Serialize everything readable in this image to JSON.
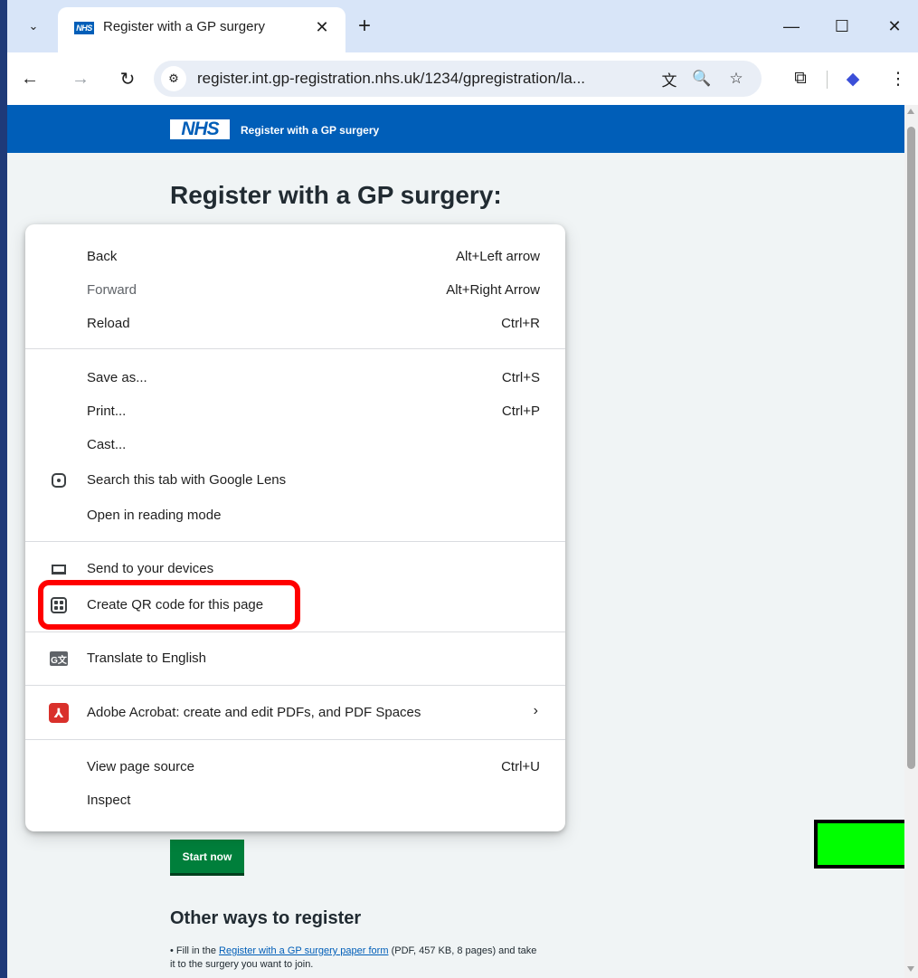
{
  "tab": {
    "favicon_text": "NHS",
    "title": "Register with a GP surgery",
    "close_glyph": "✕",
    "new_tab_glyph": "+",
    "search_glyph": "⌄"
  },
  "window_controls": {
    "minimize": "—",
    "maximize": "☐",
    "close": "✕"
  },
  "toolbar": {
    "back_glyph": "←",
    "forward_glyph": "→",
    "reload_glyph": "↻",
    "site_info_glyph": "⚙",
    "url": "register.int.gp-registration.nhs.uk/1234/gpregistration/la...",
    "translate_glyph": "文",
    "zoom_glyph": "🔍",
    "bookmark_glyph": "☆",
    "extensions_glyph": "⧉",
    "profile_glyph": "◆",
    "menu_glyph": "⋮"
  },
  "page": {
    "nhs_logo": "NHS",
    "service_name": "Register with a GP surgery",
    "title": "Register with a GP surgery:",
    "start_button": "Start now",
    "other_ways_title": "Other ways to register",
    "bullet": "•",
    "other_text_prefix": "Fill in the",
    "other_link": "Register with a GP surgery paper form",
    "other_text_suffix": "(PDF, 457 KB, 8 pages) and take it to the surgery you want to join."
  },
  "context_menu": {
    "back": {
      "label": "Back",
      "shortcut": "Alt+Left arrow"
    },
    "forward": {
      "label": "Forward",
      "shortcut": "Alt+Right Arrow"
    },
    "reload": {
      "label": "Reload",
      "shortcut": "Ctrl+R"
    },
    "save_as": {
      "label": "Save as...",
      "shortcut": "Ctrl+S"
    },
    "print": {
      "label": "Print...",
      "shortcut": "Ctrl+P"
    },
    "cast": {
      "label": "Cast..."
    },
    "google_lens": {
      "label": "Search this tab with Google Lens",
      "icon": "google-lens-icon"
    },
    "reading_mode": {
      "label": "Open in reading mode"
    },
    "send_devices": {
      "label": "Send to your devices",
      "icon": "devices-icon"
    },
    "qr_code": {
      "label": "Create QR code for this page",
      "icon": "qr-code-icon"
    },
    "translate": {
      "label": "Translate to English",
      "icon": "translate-icon",
      "glyph": "G文"
    },
    "acrobat": {
      "label": "Adobe Acrobat: create and edit PDFs, and PDF Spaces",
      "icon": "acrobat-icon",
      "glyph": "⅄",
      "arrow": "›"
    },
    "view_source": {
      "label": "View page source",
      "shortcut": "Ctrl+U"
    },
    "inspect": {
      "label": "Inspect"
    }
  },
  "colors": {
    "nhs_blue": "#005eb8",
    "start_green": "#007f3b",
    "highlight_red": "#ff0000",
    "marker_green": "#00ff00"
  }
}
